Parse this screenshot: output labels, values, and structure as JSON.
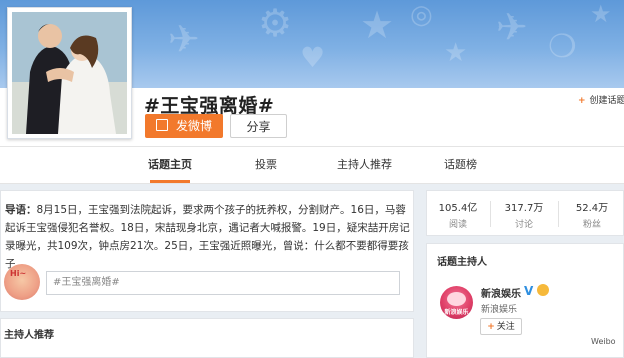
{
  "header": {
    "title": "#王宝强离婚#",
    "post_button_label": "发微博",
    "share_button_label": "分享",
    "create_topic_label": "创建话题",
    "create_topic_icon": "plus-icon"
  },
  "tabs": [
    {
      "label": "话题主页",
      "active": true
    },
    {
      "label": "投票",
      "active": false
    },
    {
      "label": "主持人推荐",
      "active": false
    },
    {
      "label": "话题榜",
      "active": false
    }
  ],
  "lead": {
    "label": "导语：",
    "text": "8月15日，王宝强到法院起诉，要求两个孩子的抚养权，分割财产。16日，马蓉起诉王宝强侵犯名誉权。18日，宋喆现身北京，遇记者大喊报警。19日，疑宋喆开房记录曝光，共109次，钟点房21次。25日，王宝强近照曝光，曾说：什么都不要都得要孩子。"
  },
  "composer": {
    "placeholder": "#王宝强离婚#",
    "avatar_text": "Hi~"
  },
  "section_hosts_recommend": "主持人推荐",
  "stats": [
    {
      "value": "105.4亿",
      "label": "阅读"
    },
    {
      "value": "317.7万",
      "label": "讨论"
    },
    {
      "value": "52.4万",
      "label": "粉丝"
    }
  ],
  "host": {
    "section_title": "话题主持人",
    "name": "新浪娱乐",
    "verified_mark": "V",
    "subtitle": "新浪娱乐",
    "avatar_text": "新浪娱乐",
    "follow_label": "关注"
  },
  "watermark": "Weibo",
  "colors": {
    "accent": "#f2792c",
    "banner": "#6fa6e0",
    "verified": "#2f8fe0"
  }
}
